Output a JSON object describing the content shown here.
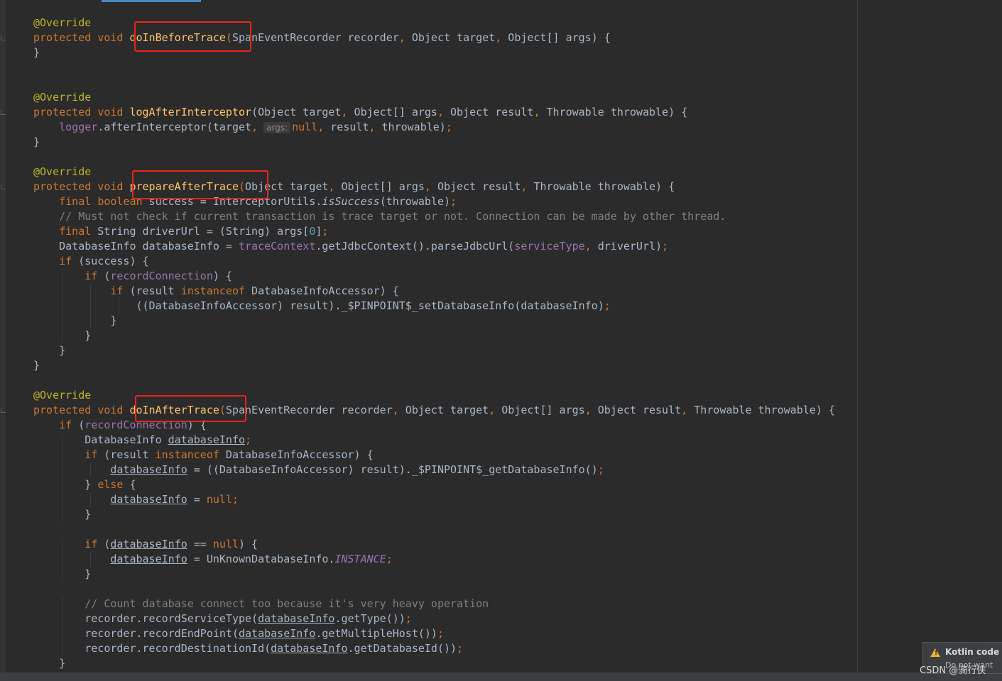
{
  "editor": {
    "lines": [
      [
        {
          "t": "@Override",
          "c": "ann"
        }
      ],
      [
        {
          "t": "protected",
          "c": "kw"
        },
        {
          "t": " "
        },
        {
          "t": "void",
          "c": "kw"
        },
        {
          "t": " "
        },
        {
          "t": "doInBeforeTrace",
          "c": "fn"
        },
        {
          "t": "(",
          "c": "kw"
        },
        {
          "t": "SpanEventRecorder recorder"
        },
        {
          "t": ",",
          "c": "kw"
        },
        {
          "t": " Object target"
        },
        {
          "t": ",",
          "c": "kw"
        },
        {
          "t": " Object[] args) {"
        }
      ],
      [
        {
          "t": "}"
        }
      ],
      [],
      [],
      [
        {
          "t": "@Override",
          "c": "ann"
        }
      ],
      [
        {
          "t": "protected",
          "c": "kw"
        },
        {
          "t": " "
        },
        {
          "t": "void",
          "c": "kw"
        },
        {
          "t": " "
        },
        {
          "t": "logAfterInterceptor",
          "c": "fn"
        },
        {
          "t": "(Object target"
        },
        {
          "t": ",",
          "c": "kw"
        },
        {
          "t": " Object[] args"
        },
        {
          "t": ",",
          "c": "kw"
        },
        {
          "t": " Object result"
        },
        {
          "t": ",",
          "c": "kw"
        },
        {
          "t": " Throwable throwable) {"
        }
      ],
      [
        {
          "t": "    "
        },
        {
          "t": "logger",
          "c": "fld"
        },
        {
          "t": ".afterInterceptor(target"
        },
        {
          "t": ",",
          "c": "kw"
        },
        {
          "t": "args:",
          "c": "hint"
        },
        {
          "t": "null",
          "c": "kw"
        },
        {
          "t": ",",
          "c": "kw"
        },
        {
          "t": " result"
        },
        {
          "t": ",",
          "c": "kw"
        },
        {
          "t": " throwable)"
        },
        {
          "t": ";",
          "c": "kw"
        }
      ],
      [
        {
          "t": "}"
        }
      ],
      [],
      [
        {
          "t": "@Override",
          "c": "ann"
        }
      ],
      [
        {
          "t": "protected",
          "c": "kw"
        },
        {
          "t": " "
        },
        {
          "t": "void",
          "c": "kw"
        },
        {
          "t": " "
        },
        {
          "t": "prepareAfterTrace",
          "c": "fn"
        },
        {
          "t": "(",
          "c": "kw"
        },
        {
          "t": "Object target"
        },
        {
          "t": ",",
          "c": "kw"
        },
        {
          "t": " Object[] args"
        },
        {
          "t": ",",
          "c": "kw"
        },
        {
          "t": " Object result"
        },
        {
          "t": ",",
          "c": "kw"
        },
        {
          "t": " Throwable throwable) {"
        }
      ],
      [
        {
          "t": "    "
        },
        {
          "t": "final",
          "c": "kw"
        },
        {
          "t": " "
        },
        {
          "t": "boolean",
          "c": "kw"
        },
        {
          "t": " success = InterceptorUtils."
        },
        {
          "t": "isSuccess",
          "c": "ital"
        },
        {
          "t": "(throwable)"
        },
        {
          "t": ";",
          "c": "kw"
        }
      ],
      [
        {
          "t": "    // Must not check if current transaction is trace target or not. Connection can be made by other thread.",
          "c": "cmt"
        }
      ],
      [
        {
          "t": "    "
        },
        {
          "t": "final",
          "c": "kw"
        },
        {
          "t": " String driverUrl = (String) args["
        },
        {
          "t": "0",
          "c": "num"
        },
        {
          "t": "]"
        },
        {
          "t": ";",
          "c": "kw"
        }
      ],
      [
        {
          "t": "    DatabaseInfo databaseInfo = "
        },
        {
          "t": "traceContext",
          "c": "fld"
        },
        {
          "t": ".getJdbcContext().parseJdbcUrl("
        },
        {
          "t": "serviceType",
          "c": "fld"
        },
        {
          "t": ",",
          "c": "kw"
        },
        {
          "t": " driverUrl)"
        },
        {
          "t": ";",
          "c": "kw"
        }
      ],
      [
        {
          "t": "    "
        },
        {
          "t": "if",
          "c": "kw"
        },
        {
          "t": " (success) {"
        }
      ],
      [
        {
          "t": "        "
        },
        {
          "t": "if",
          "c": "kw"
        },
        {
          "t": " ("
        },
        {
          "t": "recordConnection",
          "c": "fld"
        },
        {
          "t": ") {"
        }
      ],
      [
        {
          "t": "            "
        },
        {
          "t": "if",
          "c": "kw"
        },
        {
          "t": " (result "
        },
        {
          "t": "instanceof",
          "c": "kw"
        },
        {
          "t": " DatabaseInfoAccessor) {"
        }
      ],
      [
        {
          "t": "                ((DatabaseInfoAccessor) result)._$PINPOINT$_setDatabaseInfo(databaseInfo)"
        },
        {
          "t": ";",
          "c": "kw"
        }
      ],
      [
        {
          "t": "            }"
        }
      ],
      [
        {
          "t": "        }"
        }
      ],
      [
        {
          "t": "    }"
        }
      ],
      [
        {
          "t": "}"
        }
      ],
      [],
      [
        {
          "t": "@Override",
          "c": "ann"
        }
      ],
      [
        {
          "t": "protected",
          "c": "kw"
        },
        {
          "t": " "
        },
        {
          "t": "void",
          "c": "kw"
        },
        {
          "t": " "
        },
        {
          "t": "doInAfterTrace",
          "c": "fn"
        },
        {
          "t": "(",
          "c": "kw"
        },
        {
          "t": "SpanEventRecorder recorder"
        },
        {
          "t": ",",
          "c": "kw"
        },
        {
          "t": " Object target"
        },
        {
          "t": ",",
          "c": "kw"
        },
        {
          "t": " Object[] args"
        },
        {
          "t": ",",
          "c": "kw"
        },
        {
          "t": " Object result"
        },
        {
          "t": ",",
          "c": "kw"
        },
        {
          "t": " Throwable throwable) {"
        }
      ],
      [
        {
          "t": "    "
        },
        {
          "t": "if",
          "c": "kw"
        },
        {
          "t": " ("
        },
        {
          "t": "recordConnection",
          "c": "fld"
        },
        {
          "t": ") {"
        }
      ],
      [
        {
          "t": "        DatabaseInfo "
        },
        {
          "t": "databaseInfo",
          "c": "ul"
        },
        {
          "t": ";",
          "c": "kw"
        }
      ],
      [
        {
          "t": "        "
        },
        {
          "t": "if",
          "c": "kw"
        },
        {
          "t": " (result "
        },
        {
          "t": "instanceof",
          "c": "kw"
        },
        {
          "t": " DatabaseInfoAccessor) {"
        }
      ],
      [
        {
          "t": "            "
        },
        {
          "t": "databaseInfo",
          "c": "ul"
        },
        {
          "t": " = ((DatabaseInfoAccessor) result)._$PINPOINT$_getDatabaseInfo()"
        },
        {
          "t": ";",
          "c": "kw"
        }
      ],
      [
        {
          "t": "        } "
        },
        {
          "t": "else",
          "c": "kw"
        },
        {
          "t": " {"
        }
      ],
      [
        {
          "t": "            "
        },
        {
          "t": "databaseInfo",
          "c": "ul"
        },
        {
          "t": " = "
        },
        {
          "t": "null",
          "c": "kw"
        },
        {
          "t": ";",
          "c": "kw"
        }
      ],
      [
        {
          "t": "        }"
        }
      ],
      [],
      [
        {
          "t": "        "
        },
        {
          "t": "if",
          "c": "kw"
        },
        {
          "t": " ("
        },
        {
          "t": "databaseInfo",
          "c": "ul"
        },
        {
          "t": " == "
        },
        {
          "t": "null",
          "c": "kw"
        },
        {
          "t": ") {"
        }
      ],
      [
        {
          "t": "            "
        },
        {
          "t": "databaseInfo",
          "c": "ul"
        },
        {
          "t": " = UnKnownDatabaseInfo."
        },
        {
          "t": "INSTANCE",
          "c": "fld ital"
        },
        {
          "t": ";",
          "c": "kw"
        }
      ],
      [
        {
          "t": "        }"
        }
      ],
      [],
      [
        {
          "t": "        // Count database connect too because it's very heavy operation",
          "c": "cmt"
        }
      ],
      [
        {
          "t": "        recorder.recordServiceType("
        },
        {
          "t": "databaseInfo",
          "c": "ul"
        },
        {
          "t": ".getType())"
        },
        {
          "t": ";",
          "c": "kw"
        }
      ],
      [
        {
          "t": "        recorder.recordEndPoint("
        },
        {
          "t": "databaseInfo",
          "c": "ul"
        },
        {
          "t": ".getMultipleHost())"
        },
        {
          "t": ";",
          "c": "kw"
        }
      ],
      [
        {
          "t": "        recorder.recordDestinationId("
        },
        {
          "t": "databaseInfo",
          "c": "ul"
        },
        {
          "t": ".getDatabaseId())"
        },
        {
          "t": ";",
          "c": "kw"
        }
      ],
      [
        {
          "t": "    }"
        }
      ]
    ],
    "highlighted_methods": [
      "doInBeforeTrace",
      "prepareAfterTrace",
      "doInAfterTrace"
    ]
  },
  "notification": {
    "title": "Kotlin code s",
    "subtitle": "Do not want",
    "icon": "warning-icon"
  },
  "watermark": "CSDN @骑行侠",
  "colors": {
    "background": "#2b2b2b",
    "keyword": "#cc7832",
    "annotation": "#bbb529",
    "function": "#ffc66d",
    "field": "#9876aa",
    "number": "#6897bb",
    "comment": "#808080",
    "text": "#a9b7c6",
    "highlight_box": "#e8241d"
  }
}
